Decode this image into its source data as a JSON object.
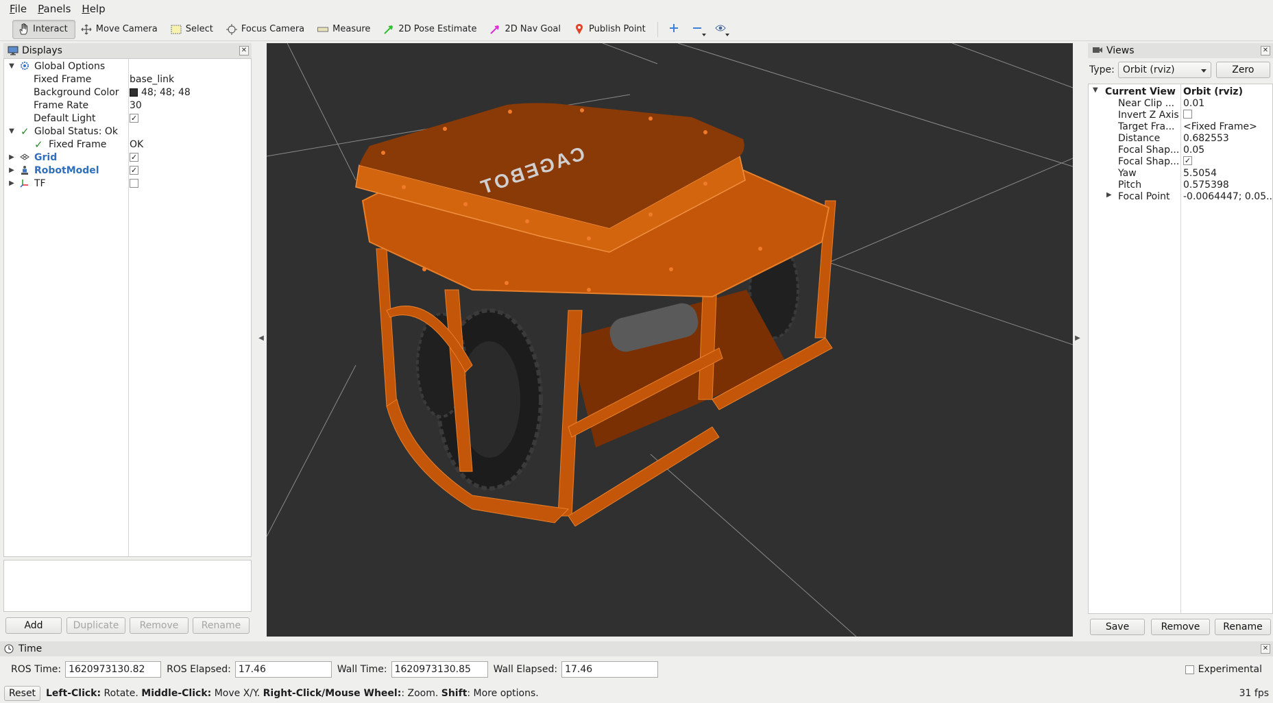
{
  "menu": [
    {
      "label": "File",
      "accel": "F",
      "rest": "ile"
    },
    {
      "label": "Panels",
      "accel": "P",
      "rest": "anels"
    },
    {
      "label": "Help",
      "accel": "H",
      "rest": "elp"
    }
  ],
  "toolbar": {
    "interact": "Interact",
    "move_camera": "Move Camera",
    "select": "Select",
    "focus_camera": "Focus Camera",
    "measure": "Measure",
    "pose_estimate": "2D Pose Estimate",
    "nav_goal": "2D Nav Goal",
    "publish_point": "Publish Point"
  },
  "displays": {
    "title": "Displays",
    "rows": {
      "global_options": "Global Options",
      "fixed_frame": "Fixed Frame",
      "fixed_frame_val": "base_link",
      "background_color": "Background Color",
      "background_color_val": "48; 48; 48",
      "frame_rate": "Frame Rate",
      "frame_rate_val": "30",
      "default_light": "Default Light",
      "global_status": "Global Status: Ok",
      "status_fixed_frame": "Fixed Frame",
      "status_fixed_frame_val": "OK",
      "grid": "Grid",
      "robot_model": "RobotModel",
      "tf": "TF"
    },
    "buttons": {
      "add": "Add",
      "duplicate": "Duplicate",
      "remove": "Remove",
      "rename": "Rename"
    }
  },
  "viewport": {
    "logo": "CAGEBOT",
    "colors": {
      "background": "#303030",
      "robot": "#c4560a",
      "robot_top": "#8a3a06"
    }
  },
  "views": {
    "title": "Views",
    "type_label": "Type:",
    "type_value": "Orbit (rviz)",
    "zero": "Zero",
    "current_view": "Current View",
    "current_view_val": "Orbit (rviz)",
    "props": [
      {
        "label": "Near Clip ...",
        "value": "0.01"
      },
      {
        "label": "Invert Z Axis",
        "value": ""
      },
      {
        "label": "Target Fra...",
        "value": "<Fixed Frame>"
      },
      {
        "label": "Distance",
        "value": "0.682553"
      },
      {
        "label": "Focal Shap...",
        "value": "0.05"
      },
      {
        "label": "Focal Shap...",
        "value": ""
      },
      {
        "label": "Yaw",
        "value": "5.5054"
      },
      {
        "label": "Pitch",
        "value": "0.575398"
      },
      {
        "label": "Focal Point",
        "value": "-0.0064447; 0.05..."
      }
    ],
    "buttons": {
      "save": "Save",
      "remove": "Remove",
      "rename": "Rename"
    }
  },
  "time": {
    "title": "Time",
    "ros_time_label": "ROS Time:",
    "ros_time": "1620973130.82",
    "ros_elapsed_label": "ROS Elapsed:",
    "ros_elapsed": "17.46",
    "wall_time_label": "Wall Time:",
    "wall_time": "1620973130.85",
    "wall_elapsed_label": "Wall Elapsed:",
    "wall_elapsed": "17.46",
    "experimental": "Experimental"
  },
  "status": {
    "reset": "Reset",
    "left_click": "Left-Click:",
    "left_click_desc": " Rotate. ",
    "middle_click": "Middle-Click:",
    "middle_click_desc": " Move X/Y. ",
    "right_click": "Right-Click/Mouse Wheel:",
    "right_click_desc": ": Zoom. ",
    "shift": "Shift",
    "shift_desc": ": More options.",
    "fps": "31 fps"
  }
}
